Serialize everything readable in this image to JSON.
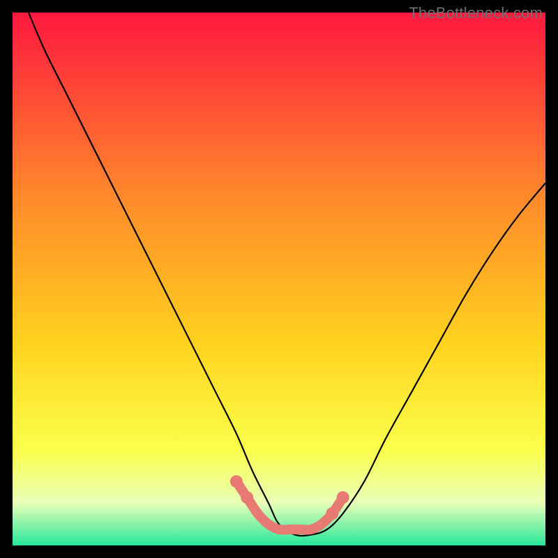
{
  "watermark": "TheBottleneck.com",
  "colors": {
    "gradient_top": "#ff183f",
    "gradient_mid1": "#ff6a2b",
    "gradient_mid2": "#ffd21e",
    "gradient_mid3": "#faff4a",
    "gradient_low": "#e9ffb8",
    "gradient_bottom": "#27e79a",
    "curve": "#000000",
    "markers": "#e77a72",
    "border": "#000000"
  },
  "chart_data": {
    "type": "line",
    "title": "",
    "xlabel": "",
    "ylabel": "",
    "xlim": [
      0,
      100
    ],
    "ylim": [
      0,
      100
    ],
    "grid": false,
    "series": [
      {
        "name": "bottleneck-curve",
        "x": [
          3,
          6,
          10,
          14,
          18,
          22,
          26,
          30,
          34,
          38,
          42,
          45,
          48,
          50,
          53,
          56,
          59,
          62,
          66,
          70,
          75,
          80,
          85,
          90,
          95,
          100
        ],
        "y": [
          100,
          93,
          85,
          77,
          69,
          61,
          53,
          45,
          37,
          29,
          21,
          14,
          8,
          4,
          2,
          2,
          3,
          6,
          12,
          20,
          29,
          38,
          47,
          55,
          62,
          68
        ]
      }
    ],
    "markers": {
      "name": "highlighted-points",
      "x": [
        42,
        44,
        46,
        48,
        50,
        52,
        54,
        56,
        58,
        60,
        62
      ],
      "y": [
        12,
        9,
        6,
        4,
        3,
        3,
        3,
        3,
        4,
        6,
        9
      ]
    },
    "legend": null
  }
}
